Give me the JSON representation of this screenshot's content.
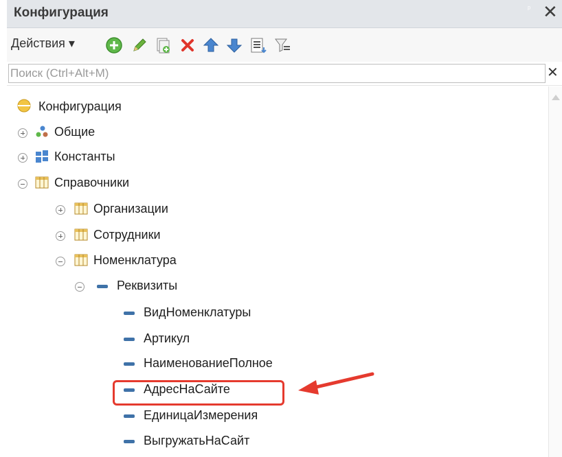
{
  "header": {
    "title": "Конфигурация",
    "pin": "ᵖ",
    "close": "✕"
  },
  "toolbar": {
    "actions_label": "Действия",
    "icons": [
      "add-icon",
      "edit-icon",
      "copy-icon",
      "delete-icon",
      "move-up-icon",
      "move-down-icon",
      "list-icon",
      "filter-icon"
    ]
  },
  "search": {
    "placeholder": "Поиск (Ctrl+Alt+M)",
    "clear": "✕"
  },
  "tree": {
    "root": "Конфигурация",
    "common": "Общие",
    "constants": "Константы",
    "catalogs": "Справочники",
    "organizations": "Организации",
    "employees": "Сотрудники",
    "nomenclature": "Номенклатура",
    "requisites": "Реквизиты",
    "attrs": [
      "ВидНоменклатуры",
      "Артикул",
      "НаименованиеПолное",
      "АдресНаСайте",
      "ЕдиницаИзмерения",
      "ВыгружатьНаСайт"
    ]
  },
  "colors": {
    "highlight": "#e53a2e",
    "arrow": "#e53a2e",
    "attr_icon": "#3f72a8"
  }
}
